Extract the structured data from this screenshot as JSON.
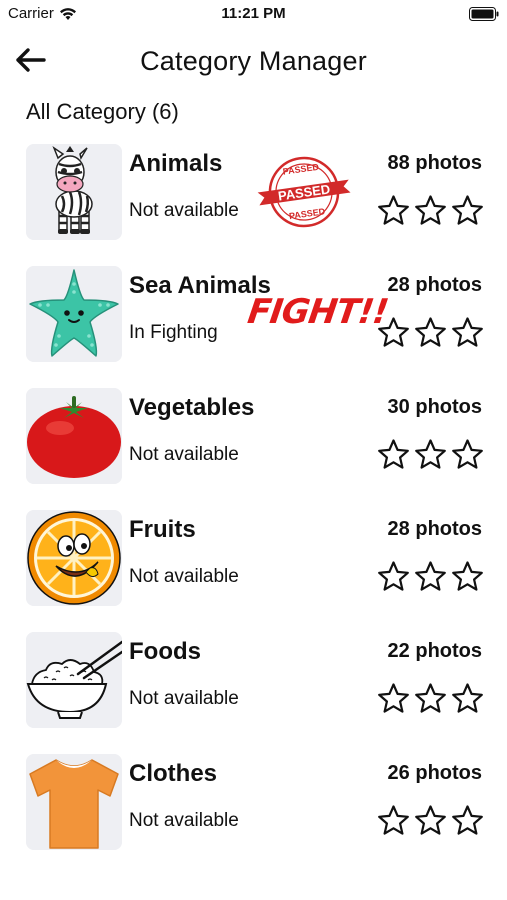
{
  "status_bar": {
    "carrier": "Carrier",
    "time": "11:21 PM"
  },
  "header": {
    "title": "Category Manager"
  },
  "section": {
    "title": "All Category (6)"
  },
  "categories": [
    {
      "name": "Animals",
      "status": "Not available",
      "photos": "88 photos",
      "stars_filled": 0,
      "icon": "zebra-icon"
    },
    {
      "name": "Sea Animals",
      "status": "In Fighting",
      "photos": "28 photos",
      "stars_filled": 0,
      "icon": "starfish-icon"
    },
    {
      "name": "Vegetables",
      "status": "Not available",
      "photos": "30 photos",
      "stars_filled": 0,
      "icon": "tomato-icon"
    },
    {
      "name": "Fruits",
      "status": "Not available",
      "photos": "28 photos",
      "stars_filled": 0,
      "icon": "orange-icon"
    },
    {
      "name": "Foods",
      "status": "Not available",
      "photos": "22 photos",
      "stars_filled": 0,
      "icon": "rice-bowl-icon"
    },
    {
      "name": "Clothes",
      "status": "Not available",
      "photos": "26 photos",
      "stars_filled": 0,
      "icon": "tshirt-icon"
    }
  ],
  "stamp": {
    "top_text": "PASSED",
    "banner_text": "PASSED",
    "bottom_text": "PASSED",
    "color": "#d22a2a"
  },
  "fight_label": "FIGHT!!",
  "colors": {
    "thumb_bg": "#eeeff3",
    "stamp_red": "#d22a2a",
    "fight_red": "#e11b1b"
  }
}
